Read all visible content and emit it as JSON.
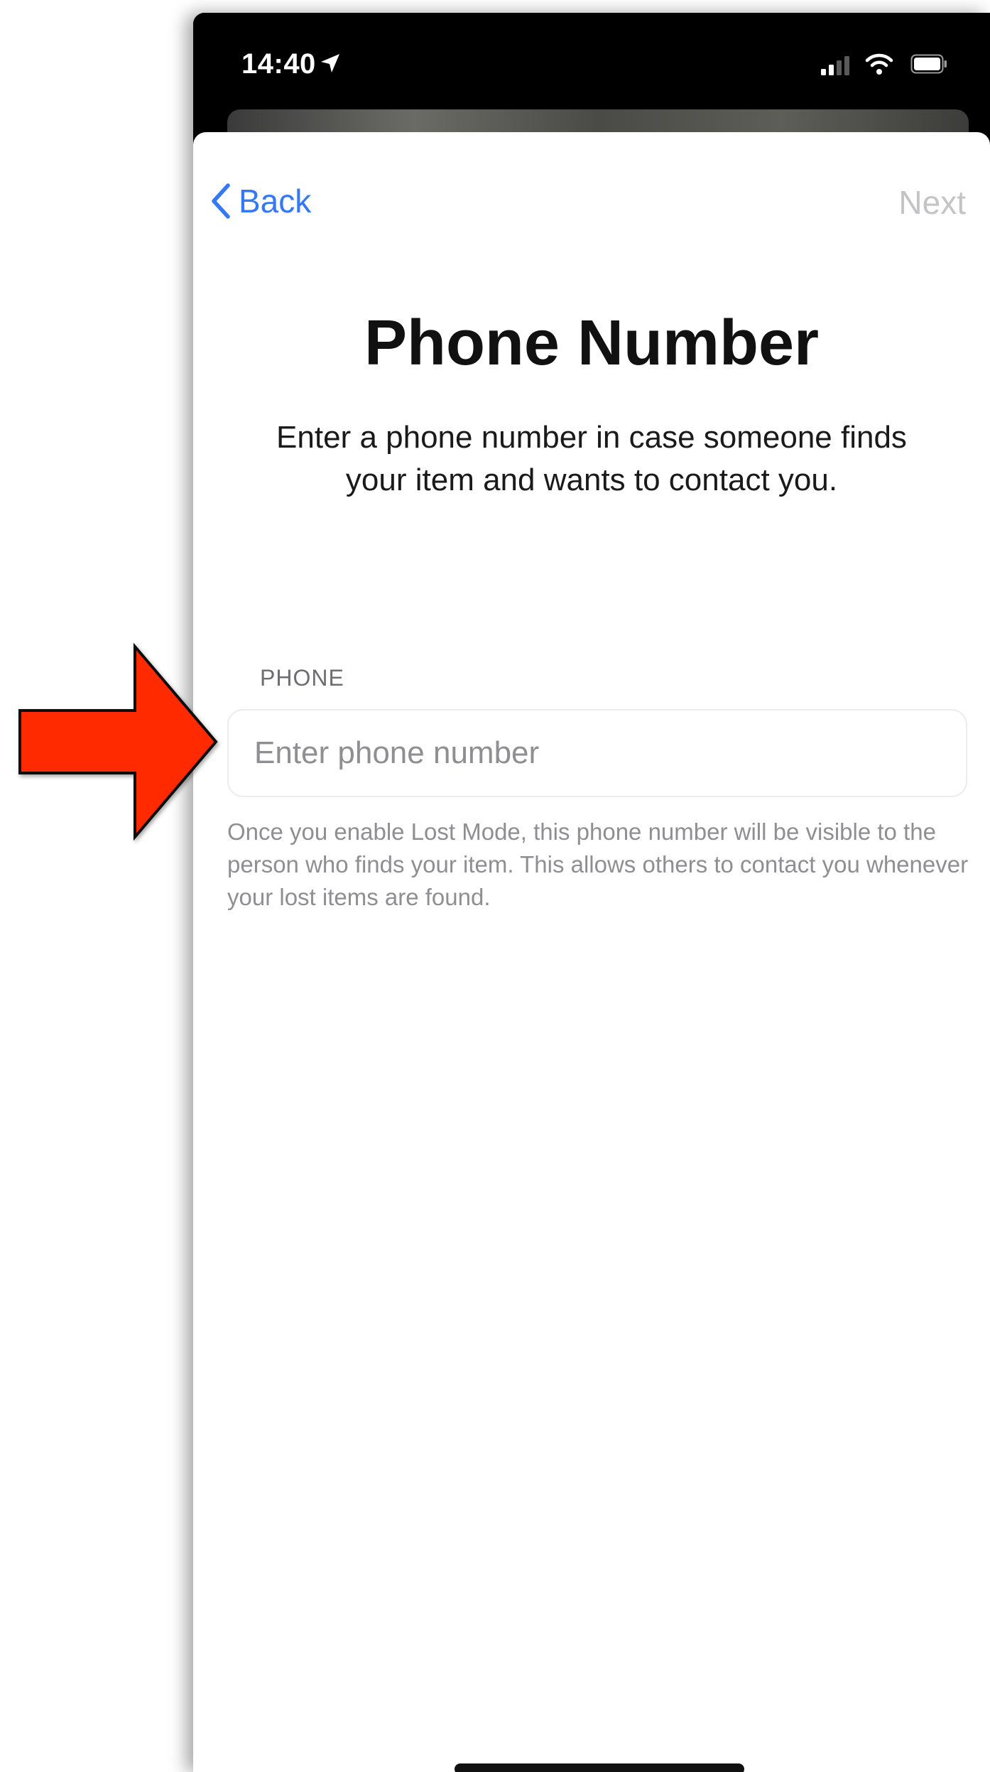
{
  "status_bar": {
    "time": "14:40",
    "location_icon": "location-arrow-icon",
    "signal_icon": "cellular-signal-icon",
    "wifi_icon": "wifi-icon",
    "battery_icon": "battery-icon"
  },
  "nav": {
    "back_label": "Back",
    "next_label": "Next",
    "back_icon": "chevron-left-icon"
  },
  "page": {
    "title": "Phone Number",
    "subtitle": "Enter a phone number in case someone finds your item and wants to contact you."
  },
  "phone_field": {
    "label": "PHONE",
    "value": "",
    "placeholder": "Enter phone number",
    "footnote": "Once you enable Lost Mode, this phone number will be visible to the person who finds your item. This allows others to contact you whenever your lost items are found."
  },
  "annotation": {
    "arrow_icon": "red-arrow-right-icon"
  },
  "colors": {
    "accent": "#3478f6",
    "next_disabled": "#c4c4c6",
    "arrow_fill": "#ff2a00",
    "footnote": "#8e8e93"
  }
}
